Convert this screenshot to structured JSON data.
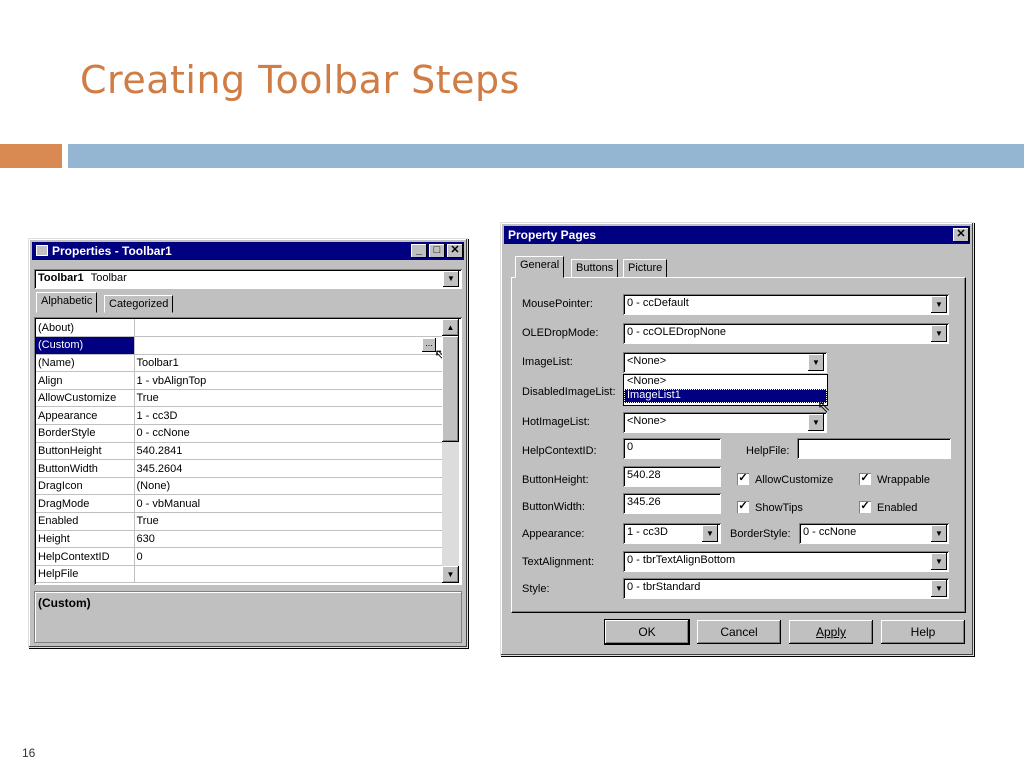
{
  "slide": {
    "title": "Creating Toolbar Steps",
    "page_number": "16"
  },
  "properties_window": {
    "title": "Properties - Toolbar1",
    "object_name": "Toolbar1",
    "object_type": "Toolbar",
    "tabs": [
      "Alphabetic",
      "Categorized"
    ],
    "rows": [
      {
        "name": "(About)",
        "value": ""
      },
      {
        "name": "(Custom)",
        "value": "",
        "selected": true
      },
      {
        "name": "(Name)",
        "value": "Toolbar1"
      },
      {
        "name": "Align",
        "value": "1 - vbAlignTop"
      },
      {
        "name": "AllowCustomize",
        "value": "True"
      },
      {
        "name": "Appearance",
        "value": "1 - cc3D"
      },
      {
        "name": "BorderStyle",
        "value": "0 - ccNone"
      },
      {
        "name": "ButtonHeight",
        "value": "540.2841"
      },
      {
        "name": "ButtonWidth",
        "value": "345.2604"
      },
      {
        "name": "DragIcon",
        "value": "(None)"
      },
      {
        "name": "DragMode",
        "value": "0 - vbManual"
      },
      {
        "name": "Enabled",
        "value": "True"
      },
      {
        "name": "Height",
        "value": "630"
      },
      {
        "name": "HelpContextID",
        "value": "0"
      },
      {
        "name": "HelpFile",
        "value": ""
      }
    ],
    "ellipsis": "...",
    "description": "(Custom)"
  },
  "property_pages": {
    "title": "Property Pages",
    "tabs": [
      "General",
      "Buttons",
      "Picture"
    ],
    "labels": {
      "mouse_pointer": "MousePointer:",
      "ole_drop_mode": "OLEDropMode:",
      "image_list": "ImageList:",
      "disabled_image_list": "DisabledImageList:",
      "hot_image_list": "HotImageList:",
      "help_context_id": "HelpContextID:",
      "help_file": "HelpFile:",
      "button_height": "ButtonHeight:",
      "button_width": "ButtonWidth:",
      "appearance": "Appearance:",
      "border_style": "BorderStyle:",
      "text_alignment": "TextAlignment:",
      "style": "Style:"
    },
    "values": {
      "mouse_pointer": "0 - ccDefault",
      "ole_drop_mode": "0 - ccOLEDropNone",
      "image_list": "<None>",
      "hot_image_list": "<None>",
      "help_context_id": "0",
      "help_file": "",
      "button_height": "540.28",
      "button_width": "345.26",
      "appearance": "1 - cc3D",
      "border_style": "0 - ccNone",
      "text_alignment": "0 - tbrTextAlignBottom",
      "style": "0 - tbrStandard"
    },
    "image_list_options": [
      "<None>",
      "ImageList1"
    ],
    "checkboxes": {
      "allow_customize": "AllowCustomize",
      "wrappable": "Wrappable",
      "show_tips": "ShowTips",
      "enabled": "Enabled"
    },
    "buttons": {
      "ok": "OK",
      "cancel": "Cancel",
      "apply": "Apply",
      "help": "Help"
    }
  }
}
